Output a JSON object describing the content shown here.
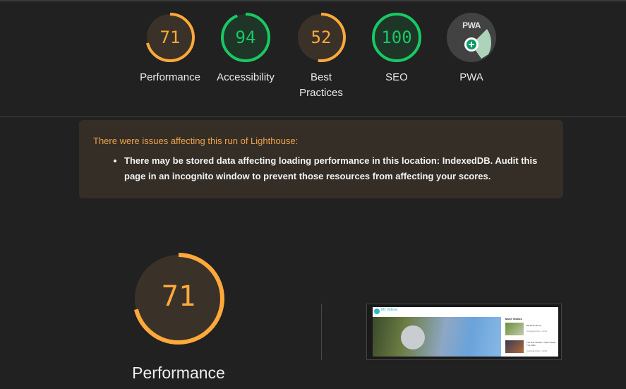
{
  "scores": [
    {
      "value": "71",
      "label": "Performance",
      "fraction": 0.71,
      "color": "#ffa93a"
    },
    {
      "value": "94",
      "label": "Accessibility",
      "fraction": 0.94,
      "color": "#18c964"
    },
    {
      "value": "52",
      "label": "Best Practices",
      "fraction": 0.52,
      "color": "#ffa93a"
    },
    {
      "value": "100",
      "label": "SEO",
      "fraction": 1.0,
      "color": "#18c964"
    },
    {
      "value": "PWA",
      "label": "PWA",
      "badge_text": "PWA",
      "icon": "pwa-badge-icon"
    }
  ],
  "warning": {
    "title": "There were issues affecting this run of Lighthouse:",
    "items": [
      "There may be stored data affecting loading performance in this location: IndexedDB. Audit this page in an incognito window to prevent those resources from affecting your scores."
    ]
  },
  "performance": {
    "value": "71",
    "fraction": 0.71,
    "label": "Performance",
    "color": "#ffa93a"
  },
  "screenshot": {
    "site_title": "My Videos",
    "side_title": "More Videos",
    "items": [
      {
        "title": "Big Buck Bunny",
        "meta": "Uploaded Sep 1 2021"
      },
      {
        "title": "The Dub Wonder: Open Planet TVs 2021",
        "meta": "Uploaded Sep 1 2021"
      }
    ]
  },
  "colors": {
    "background": "#212121",
    "orange": "#ffa93a",
    "green": "#18c964",
    "warning_bg": "#342e26"
  }
}
